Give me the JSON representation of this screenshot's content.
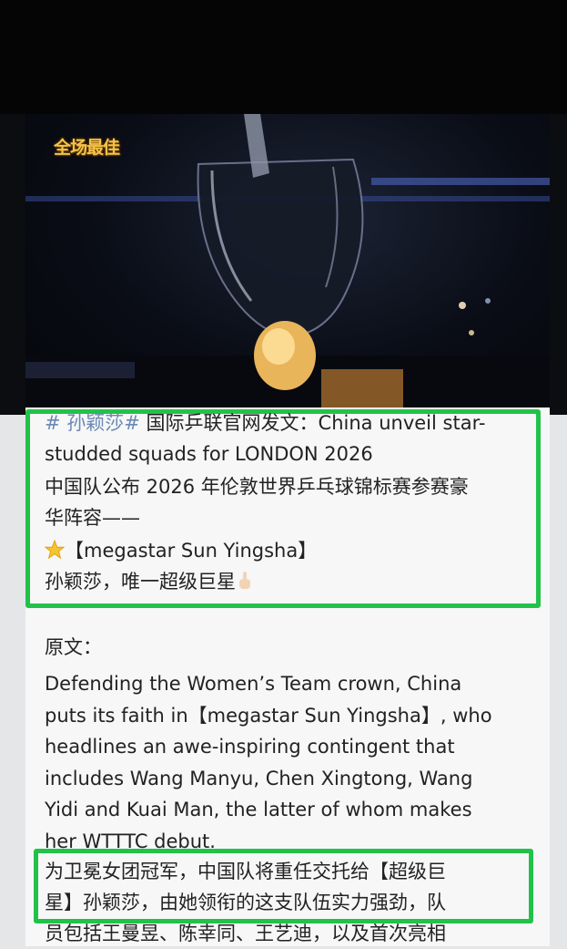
{
  "video": {
    "overlay_logo": "全场最佳"
  },
  "post": {
    "hashtag": "# 孙颖莎#",
    "line1_rest": " 国际乒联官网发文：China unveil star-",
    "line2": "studded squads for LONDON 2026",
    "line3": "中国队公布 2026 年伦敦世界乒乓球锦标赛参赛豪",
    "line4": "华阵容——",
    "line5": "【megastar Sun Yingsha】",
    "line6": "孙颖莎，唯一超级巨星",
    "original_label": "原文：",
    "english": [
      "Defending the Women’s Team crown, China",
      "puts its faith in【megastar Sun Yingsha】, who",
      "headlines an awe-inspiring contingent that",
      "includes Wang Manyu, Chen Xingtong, Wang",
      "Yidi and Kuai Man, the latter of whom makes",
      "her WTTTC debut."
    ],
    "chinese": [
      "为卫冕女团冠军，中国队将重任交托给【超级巨",
      "星】孙颖莎，由她领衔的这支队伍实力强劲，队",
      "员包括王曼昱、陈幸同、王艺迪，以及首次亮相"
    ]
  },
  "colors": {
    "highlight": "#22c24a",
    "hashtag": "#6a88b5"
  },
  "icons": [
    "star-emoji-icon",
    "pointing-up-hand-icon"
  ]
}
